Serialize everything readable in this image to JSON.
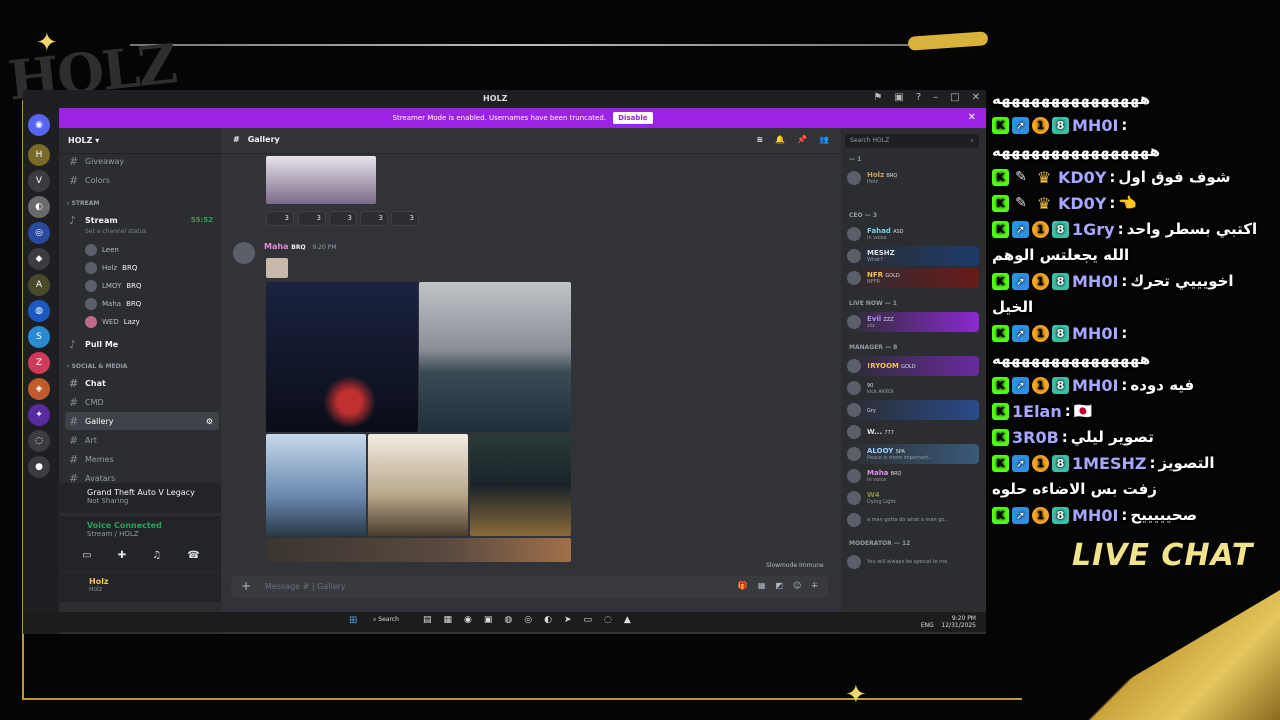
{
  "overlay": {
    "live_chat_title": "LIVE CHAT"
  },
  "chat_lines": [
    {
      "user": "",
      "message": "هههههههههههههههه",
      "badges": []
    },
    {
      "user": "MH0I",
      "message": "",
      "badges": [
        "K",
        "arrow",
        "1",
        "sub"
      ]
    },
    {
      "user": "",
      "message": "ههههههههههههههههه",
      "badges": []
    },
    {
      "user": "KD0Y",
      "message": "شوف فوق اول",
      "badges": [
        "K",
        "feather",
        "crown"
      ]
    },
    {
      "user": "KD0Y",
      "message": "👈",
      "badges": [
        "K",
        "feather",
        "crown"
      ]
    },
    {
      "user": "1Gry",
      "message": "اكتبي بسطر واحد",
      "badges": [
        "K",
        "arrow",
        "1",
        "sub"
      ]
    },
    {
      "user": "",
      "message": "الله يجعلتس الوهم",
      "badges": []
    },
    {
      "user": "MH0I",
      "message": "اخويييي تحرك",
      "badges": [
        "K",
        "arrow",
        "1",
        "sub"
      ]
    },
    {
      "user": "",
      "message": "الخيل",
      "badges": []
    },
    {
      "user": "MH0I",
      "message": "",
      "badges": [
        "K",
        "arrow",
        "1",
        "sub"
      ]
    },
    {
      "user": "",
      "message": "هههههههههههههههه",
      "badges": []
    },
    {
      "user": "MH0I",
      "message": "فيه دوده",
      "badges": [
        "K",
        "arrow",
        "1",
        "sub"
      ]
    },
    {
      "user": "1Elan",
      "message": "🇯🇵",
      "badges": [
        "K"
      ]
    },
    {
      "user": "3R0B",
      "message": "تصوير ليلي",
      "badges": [
        "K"
      ]
    },
    {
      "user": "1MESHZ",
      "message": "التصويز",
      "badges": [
        "K",
        "arrow",
        "1",
        "sub"
      ]
    },
    {
      "user": "",
      "message": "زفت بس الاضاءه حلوه",
      "badges": []
    },
    {
      "user": "MH0I",
      "message": "صحيييييح",
      "badges": [
        "K",
        "arrow",
        "1",
        "sub"
      ]
    }
  ],
  "discord": {
    "window_title": "HOLZ",
    "streamer_banner": "Streamer Mode is enabled. Usernames have been truncated.",
    "disable_label": "Disable",
    "server_name": "HOLZ",
    "channels_top": [
      {
        "name": "Giveaway"
      },
      {
        "name": "Colors"
      }
    ],
    "stream_category": "STREAM",
    "stream_channel": "Stream",
    "stream_status": "Set a channel status",
    "stream_timer": "55:52",
    "voice_users": [
      "Leen",
      "Holz",
      "LMOY",
      "Maha",
      "WED"
    ],
    "voice_tags": [
      "",
      "BRQ",
      "BRQ",
      "BRQ",
      "Lazy"
    ],
    "pull_me": "Pull Me",
    "social_category": "SOCIAL & MEDIA",
    "social_channels": [
      {
        "name": "Chat"
      },
      {
        "name": "CMD"
      },
      {
        "name": "Gallery"
      },
      {
        "name": "Art"
      },
      {
        "name": "Memes"
      },
      {
        "name": "Avatars"
      }
    ],
    "activity_game": "Grand Theft Auto V Legacy",
    "activity_status": "Not Sharing",
    "voice_connected": "Voice Connected",
    "voice_channel": "Stream / HOLZ",
    "user_name": "Holz",
    "user_sub": "Holz",
    "current_channel": "Gallery",
    "reaction_counts": [
      "3",
      "3",
      "3",
      "3",
      "3"
    ],
    "message_author": "Maha",
    "message_tag": "BRQ",
    "message_time": "9:20 PM",
    "slowmode": "Slowmode Immune",
    "input_placeholder": "Message # | Gallery",
    "search_placeholder": "Search HOLZ",
    "member_groups": [
      {
        "label": "— 1"
      },
      {
        "label": "CEO — 3"
      },
      {
        "label": "LIVE NOW — 1"
      },
      {
        "label": "MANAGER — 8"
      },
      {
        "label": "MODERATOR — 12"
      }
    ],
    "members": [
      {
        "name": "Holz",
        "tag": "BRQ",
        "sub": "Holz"
      },
      {
        "name": "Fahad",
        "tag": "ASD",
        "sub": "In voice"
      },
      {
        "name": "MESHZ",
        "tag": "",
        "sub": "What?"
      },
      {
        "name": "NFR",
        "tag": "GOLD",
        "sub": "NFFR"
      },
      {
        "name": "Evil",
        "tag": "ZZZ",
        "sub": "zzz"
      },
      {
        "name": "!RYOOM",
        "tag": "GOLD",
        "sub": ""
      },
      {
        "name": "",
        "tag": "90",
        "sub": "kick AKKOI"
      },
      {
        "name": "",
        "tag": "Gry",
        "sub": ""
      },
      {
        "name": "W...",
        "tag": "777",
        "sub": ""
      },
      {
        "name": "ALOOY",
        "tag": "SPA",
        "sub": "Peace is more important..."
      },
      {
        "name": "Maha",
        "tag": "BRQ",
        "sub": "In voice"
      },
      {
        "name": "W4",
        "tag": "",
        "sub": "Dying Light"
      },
      {
        "name": "",
        "tag": "",
        "sub": "a man gotta do what a man go..."
      },
      {
        "name": "",
        "tag": "",
        "sub": "You will always be special to me."
      }
    ]
  },
  "taskbar": {
    "search": "Search",
    "lang": "ENG",
    "time": "9:20 PM",
    "date": "12/31/2025"
  },
  "colors": {
    "accent_purple": "#9b23e5",
    "gold": "#d8b23a",
    "kick_green": "#53fc18"
  }
}
